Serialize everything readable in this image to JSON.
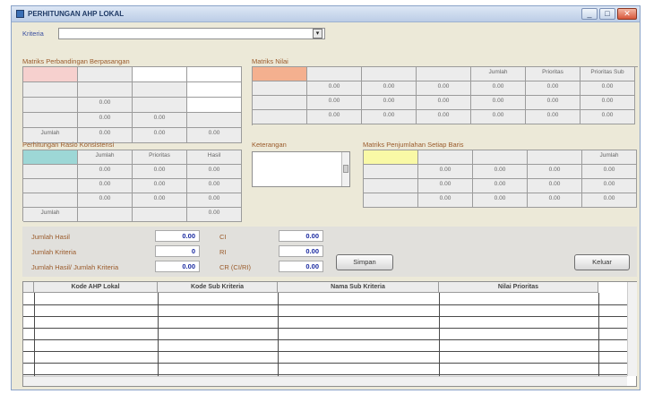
{
  "window": {
    "title": "PERHITUNGAN AHP LOKAL",
    "min_symbol": "_",
    "max_symbol": "□",
    "close_symbol": "✕"
  },
  "kriteria": {
    "label": "Kriteria",
    "value": "",
    "arrow": "▾"
  },
  "matriks_perbandingan": {
    "title": "Matriks Perbandingan Berpasangan",
    "rows": [
      [
        "",
        "",
        "",
        ""
      ],
      [
        "",
        "",
        "",
        ""
      ],
      [
        "",
        "0.00",
        "",
        ""
      ],
      [
        "",
        "0.00",
        "0.00",
        ""
      ],
      [
        "Jumlah",
        "0.00",
        "0.00",
        "0.00"
      ]
    ]
  },
  "matriks_nilai": {
    "title": "Matriks Nilai",
    "header": [
      "",
      "",
      "",
      "",
      "Jumlah",
      "Prioritas",
      "Prioritas Sub"
    ],
    "rows": [
      [
        "",
        "0.00",
        "0.00",
        "0.00",
        "0.00",
        "0.00",
        "0.00"
      ],
      [
        "",
        "0.00",
        "0.00",
        "0.00",
        "0.00",
        "0.00",
        "0.00"
      ],
      [
        "",
        "0.00",
        "0.00",
        "0.00",
        "0.00",
        "0.00",
        "0.00"
      ]
    ]
  },
  "rasio_konsistensi": {
    "title": "Perhitungan Rasio Konsistensi",
    "header": [
      "",
      "Jumlah",
      "Prioritas",
      "Hasil"
    ],
    "rows": [
      [
        "",
        "0.00",
        "0.00",
        "0.00"
      ],
      [
        "",
        "0.00",
        "0.00",
        "0.00"
      ],
      [
        "",
        "0.00",
        "0.00",
        "0.00"
      ],
      [
        "Jumlah",
        "",
        "",
        "0.00"
      ]
    ]
  },
  "keterangan": {
    "title": "Keterangan",
    "value": ""
  },
  "matriks_penjumlahan": {
    "title": "Matriks Penjumlahan Setiap Baris",
    "header": [
      "",
      "",
      "",
      "",
      "Jumlah"
    ],
    "rows": [
      [
        "",
        "0.00",
        "0.00",
        "0.00",
        "0.00"
      ],
      [
        "",
        "0.00",
        "0.00",
        "0.00",
        "0.00"
      ],
      [
        "",
        "0.00",
        "0.00",
        "0.00",
        "0.00"
      ]
    ]
  },
  "summary": {
    "jumlah_hasil_label": "Jumlah Hasil",
    "jumlah_hasil": "0.00",
    "jumlah_kriteria_label": "Jumlah Kriteria",
    "jumlah_kriteria": "0",
    "hasil_per_kriteria_label": "Jumlah Hasil/ Jumlah Kriteria",
    "hasil_per_kriteria": "0.00",
    "ci_label": "CI",
    "ci": "0.00",
    "ri_label": "RI",
    "ri": "0.00",
    "cr_label": "CR (CI/RI)",
    "cr": "0.00"
  },
  "buttons": {
    "simpan": "Simpan",
    "keluar": "Keluar"
  },
  "table": {
    "columns": [
      "Kode AHP Lokal",
      "Kode Sub Kriteria",
      "Nama Sub Kriteria",
      "Nilai Prioritas"
    ]
  }
}
